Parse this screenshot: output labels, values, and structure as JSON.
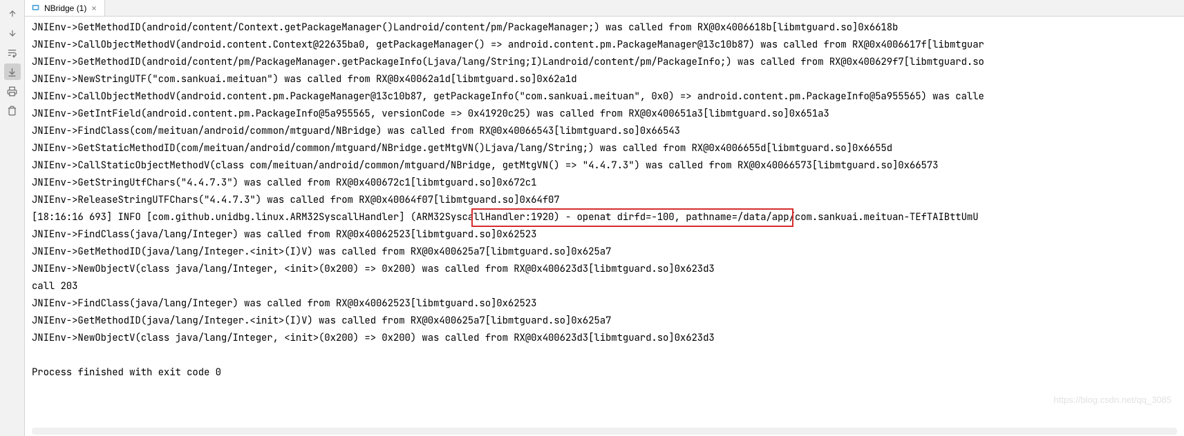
{
  "tab": {
    "title": "NBridge (1)"
  },
  "highlight_text": "callHandler:1920) - openat dirfd=-100, pathname=/data/a",
  "lines": [
    "JNIEnv->GetMethodID(android/content/Context.getPackageManager()Landroid/content/pm/PackageManager;) was called from RX@0x4006618b[libmtguard.so]0x6618b",
    "JNIEnv->CallObjectMethodV(android.content.Context@22635ba0, getPackageManager() => android.content.pm.PackageManager@13c10b87) was called from RX@0x4006617f[libmtguar",
    "JNIEnv->GetMethodID(android/content/pm/PackageManager.getPackageInfo(Ljava/lang/String;I)Landroid/content/pm/PackageInfo;) was called from RX@0x400629f7[libmtguard.so",
    "JNIEnv->NewStringUTF(\"com.sankuai.meituan\") was called from RX@0x40062a1d[libmtguard.so]0x62a1d",
    "JNIEnv->CallObjectMethodV(android.content.pm.PackageManager@13c10b87, getPackageInfo(\"com.sankuai.meituan\", 0x0) => android.content.pm.PackageInfo@5a955565) was calle",
    "JNIEnv->GetIntField(android.content.pm.PackageInfo@5a955565, versionCode => 0x41920c25) was called from RX@0x400651a3[libmtguard.so]0x651a3",
    "JNIEnv->FindClass(com/meituan/android/common/mtguard/NBridge) was called from RX@0x40066543[libmtguard.so]0x66543",
    "JNIEnv->GetStaticMethodID(com/meituan/android/common/mtguard/NBridge.getMtgVN()Ljava/lang/String;) was called from RX@0x4006655d[libmtguard.so]0x6655d",
    "JNIEnv->CallStaticObjectMethodV(class com/meituan/android/common/mtguard/NBridge, getMtgVN() => \"4.4.7.3\") was called from RX@0x40066573[libmtguard.so]0x66573",
    "JNIEnv->GetStringUtfChars(\"4.4.7.3\") was called from RX@0x400672c1[libmtguard.so]0x672c1",
    "JNIEnv->ReleaseStringUTFChars(\"4.4.7.3\") was called from RX@0x40064f07[libmtguard.so]0x64f07",
    "[18:16:16 693]  INFO [com.github.unidbg.linux.ARM32SyscallHandler] (ARM32SyscallHandler:1920) - openat dirfd=-100, pathname=/data/app/com.sankuai.meituan-TEfTAIBttUmU",
    "JNIEnv->FindClass(java/lang/Integer) was called from RX@0x40062523[libmtguard.so]0x62523",
    "JNIEnv->GetMethodID(java/lang/Integer.<init>(I)V) was called from RX@0x400625a7[libmtguard.so]0x625a7",
    "JNIEnv->NewObjectV(class java/lang/Integer, <init>(0x200) => 0x200) was called from RX@0x400623d3[libmtguard.so]0x623d3",
    "call 203",
    "JNIEnv->FindClass(java/lang/Integer) was called from RX@0x40062523[libmtguard.so]0x62523",
    "JNIEnv->GetMethodID(java/lang/Integer.<init>(I)V) was called from RX@0x400625a7[libmtguard.so]0x625a7",
    "JNIEnv->NewObjectV(class java/lang/Integer, <init>(0x200) => 0x200) was called from RX@0x400623d3[libmtguard.so]0x623d3",
    "",
    "Process finished with exit code 0"
  ],
  "watermark": "https://blog.csdn.net/qq_3085"
}
